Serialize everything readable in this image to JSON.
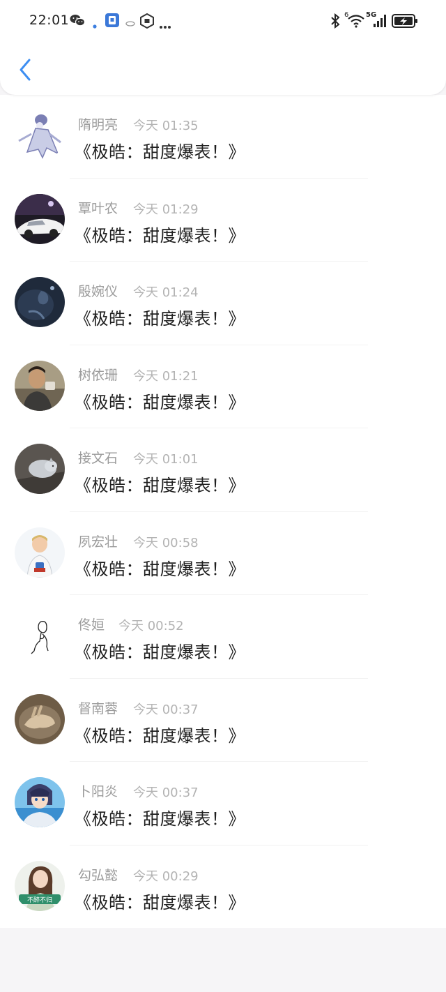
{
  "status_bar": {
    "time": "22:01",
    "network_label": "5G",
    "signal_sub_label": "6",
    "icons": [
      "wechat-icon",
      "dot-icon",
      "app-icon",
      "link-icon",
      "hexagon-icon",
      "more-icon",
      "bluetooth-icon",
      "wifi-icon",
      "signal-icon",
      "battery-charging-icon"
    ]
  },
  "nav": {
    "back_icon": "chevron-left-icon",
    "accent_color": "#3d8ef2"
  },
  "comments": [
    {
      "name": "隋明亮",
      "time": "今天 01:35",
      "text": "《极皓：甜度爆表！》",
      "avatar": "cartoon-figure"
    },
    {
      "name": "覃叶农",
      "time": "今天 01:29",
      "text": "《极皓：甜度爆表！》",
      "avatar": "white-car"
    },
    {
      "name": "殷婉仪",
      "time": "今天 01:24",
      "text": "《极皓：甜度爆表！》",
      "avatar": "dark-flower"
    },
    {
      "name": "树依珊",
      "time": "今天 01:21",
      "text": "《极皓：甜度爆表！》",
      "avatar": "man-selfie"
    },
    {
      "name": "接文石",
      "time": "今天 01:01",
      "text": "《极皓：甜度爆表！》",
      "avatar": "grey-cat"
    },
    {
      "name": "夙宏壮",
      "time": "今天 00:58",
      "text": "《极皓：甜度爆表！》",
      "avatar": "child"
    },
    {
      "name": "佟姮",
      "time": "今天 00:52",
      "text": "《极皓：甜度爆表！》",
      "avatar": "line-sketch"
    },
    {
      "name": "督南蓉",
      "time": "今天 00:37",
      "text": "《极皓：甜度爆表！》",
      "avatar": "brown-hand"
    },
    {
      "name": "卜阳炎",
      "time": "今天 00:37",
      "text": "《极皓：甜度爆表！》",
      "avatar": "anime-character"
    },
    {
      "name": "勾弘懿",
      "time": "今天 00:29",
      "text": "《极皓：甜度爆表！》",
      "avatar": "girl-with-sign",
      "avatar_text": "不醉不归"
    }
  ]
}
